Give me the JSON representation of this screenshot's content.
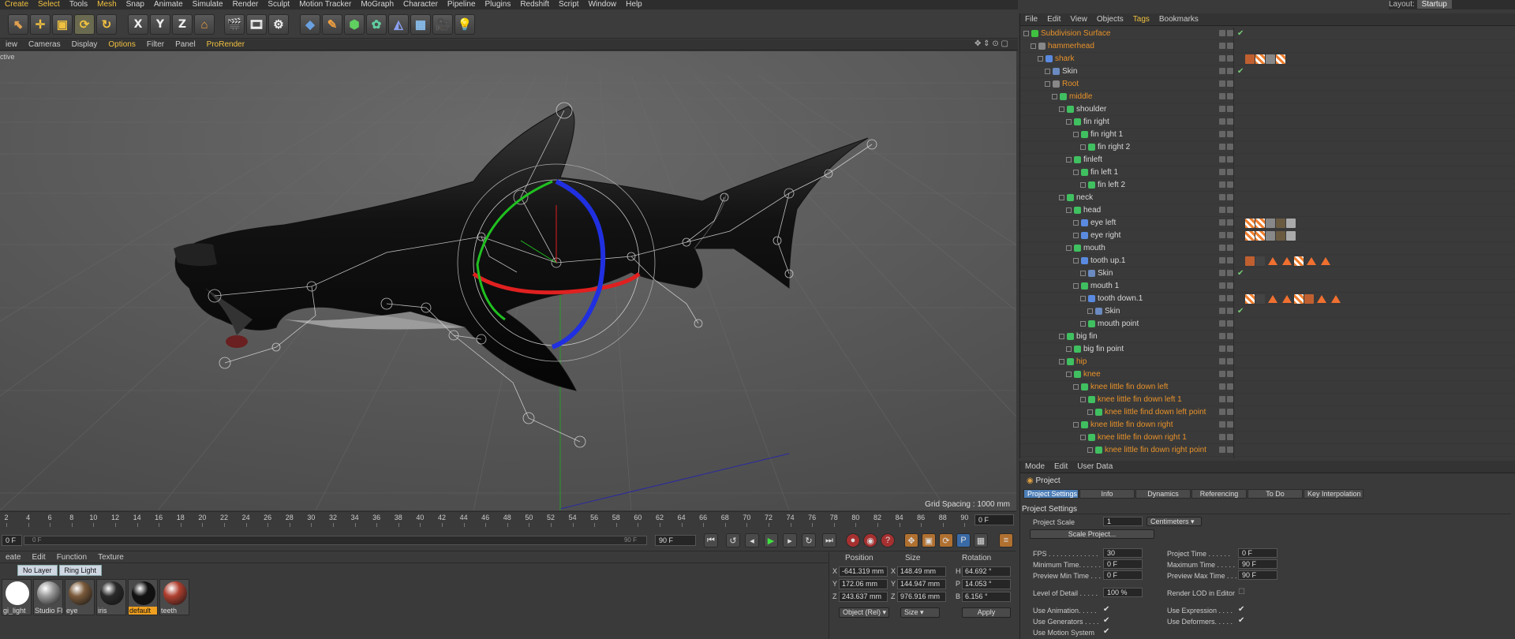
{
  "menubar": [
    "Create",
    "Select",
    "Tools",
    "Mesh",
    "Snap",
    "Animate",
    "Simulate",
    "Render",
    "Sculpt",
    "Motion Tracker",
    "MoGraph",
    "Character",
    "Pipeline",
    "Plugins",
    "Redshift",
    "Script",
    "Window",
    "Help"
  ],
  "layout": {
    "label": "Layout:",
    "value": "Startup"
  },
  "toolbar": {
    "x": "X",
    "y": "Y",
    "z": "Z"
  },
  "viewport_menu": [
    "iew",
    "Cameras",
    "Display",
    "Options",
    "Filter",
    "Panel",
    "ProRender"
  ],
  "viewport": {
    "label": "ctive",
    "grid_spacing": "Grid Spacing : 1000 mm"
  },
  "timeline": {
    "ticks": [
      "2",
      "4",
      "6",
      "8",
      "10",
      "12",
      "14",
      "16",
      "18",
      "20",
      "22",
      "24",
      "26",
      "28",
      "30",
      "32",
      "34",
      "36",
      "38",
      "40",
      "42",
      "44",
      "46",
      "48",
      "50",
      "52",
      "54",
      "56",
      "58",
      "60",
      "62",
      "64",
      "66",
      "68",
      "70",
      "72",
      "74",
      "76",
      "78",
      "80",
      "82",
      "84",
      "86",
      "88",
      "90"
    ],
    "current_frame": "0 F"
  },
  "playbar": {
    "start": "0 F",
    "range_start": "0 F",
    "range_end": "90 F",
    "end": "90 F"
  },
  "material_manager": {
    "menu": [
      "eate",
      "Edit",
      "Function",
      "Texture"
    ],
    "layers": [
      "No Layer",
      "Ring Light"
    ],
    "materials": [
      {
        "name": "gi_light",
        "color": "#ffffff"
      },
      {
        "name": "Studio Fl",
        "color": "#9a9a9a"
      },
      {
        "name": "eye",
        "color": "#7a5a3a"
      },
      {
        "name": "iris",
        "color": "#2a2a2a"
      },
      {
        "name": "default",
        "color": "#111111"
      },
      {
        "name": "teeth",
        "color": "#b04030"
      }
    ]
  },
  "coordinates": {
    "headers": [
      "Position",
      "Size",
      "Rotation"
    ],
    "axes": [
      "X",
      "Y",
      "Z"
    ],
    "rot_axes": [
      "H",
      "P",
      "B"
    ],
    "position": [
      "-641.319 mm",
      "172.06 mm",
      "243.637 mm"
    ],
    "size": [
      "148.49 mm",
      "144.947 mm",
      "976.916 mm"
    ],
    "rotation": [
      "64.692 °",
      "14.053 °",
      "6.156 °"
    ],
    "mode": "Object (Rel)",
    "size_mode": "Size",
    "apply": "Apply"
  },
  "object_manager": {
    "menu": [
      "File",
      "Edit",
      "View",
      "Objects",
      "Tags",
      "Bookmarks"
    ],
    "rows": [
      {
        "name": "Subdivision Surface",
        "indent": 0,
        "orange": true
      },
      {
        "name": "hammerhead",
        "indent": 1,
        "orange": true
      },
      {
        "name": "shark",
        "indent": 2,
        "orange": true
      },
      {
        "name": "Skin",
        "indent": 3,
        "orange": false
      },
      {
        "name": "Root",
        "indent": 3,
        "orange": true
      },
      {
        "name": "middle",
        "indent": 4,
        "orange": true
      },
      {
        "name": "shoulder",
        "indent": 5,
        "orange": false
      },
      {
        "name": "fin right",
        "indent": 6,
        "orange": false
      },
      {
        "name": "fin right 1",
        "indent": 7,
        "orange": false
      },
      {
        "name": "fin right 2",
        "indent": 8,
        "orange": false
      },
      {
        "name": "finleft",
        "indent": 6,
        "orange": false
      },
      {
        "name": "fin left 1",
        "indent": 7,
        "orange": false
      },
      {
        "name": "fin left 2",
        "indent": 8,
        "orange": false
      },
      {
        "name": "neck",
        "indent": 5,
        "orange": false
      },
      {
        "name": "head",
        "indent": 6,
        "orange": false
      },
      {
        "name": "eye left",
        "indent": 7,
        "orange": false
      },
      {
        "name": "eye right",
        "indent": 7,
        "orange": false
      },
      {
        "name": "mouth",
        "indent": 6,
        "orange": false
      },
      {
        "name": "tooth up.1",
        "indent": 7,
        "orange": false
      },
      {
        "name": "Skin",
        "indent": 8,
        "orange": false
      },
      {
        "name": "mouth 1",
        "indent": 7,
        "orange": false
      },
      {
        "name": "tooth down.1",
        "indent": 8,
        "orange": false
      },
      {
        "name": "Skin",
        "indent": 9,
        "orange": false
      },
      {
        "name": "mouth point",
        "indent": 8,
        "orange": false
      },
      {
        "name": "big fin",
        "indent": 5,
        "orange": false
      },
      {
        "name": "big fin point",
        "indent": 6,
        "orange": false
      },
      {
        "name": "hip",
        "indent": 5,
        "orange": true
      },
      {
        "name": "knee",
        "indent": 6,
        "orange": true
      },
      {
        "name": "knee little fin down left",
        "indent": 7,
        "orange": true
      },
      {
        "name": "knee little fin down left 1",
        "indent": 8,
        "orange": true
      },
      {
        "name": "knee little find down left point",
        "indent": 9,
        "orange": true
      },
      {
        "name": "knee little fin down right",
        "indent": 7,
        "orange": true
      },
      {
        "name": "knee little fin down right 1",
        "indent": 8,
        "orange": true
      },
      {
        "name": "knee little fin down right point",
        "indent": 9,
        "orange": true
      }
    ]
  },
  "attributes": {
    "menu": [
      "Mode",
      "Edit",
      "User Data"
    ],
    "title": "Project",
    "tabs": [
      "Project Settings",
      "Info",
      "Dynamics",
      "Referencing",
      "To Do",
      "Key Interpolation"
    ],
    "section": "Project Settings",
    "project_scale_label": "Project Scale",
    "project_scale_value": "1",
    "project_scale_unit": "Centimeters",
    "scale_project_btn": "Scale Project...",
    "fps_label": "FPS . . . . . . . . . . . . .",
    "fps": "30",
    "project_time_label": "Project Time . . . . . .",
    "project_time": "0 F",
    "min_time_label": "Minimum Time. . . . . .",
    "min_time": "0 F",
    "max_time_label": "Maximum Time . . . . .",
    "max_time": "90 F",
    "prev_min_label": "Preview Min Time . . .",
    "prev_min": "0 F",
    "prev_max_label": "Preview Max Time . . .",
    "prev_max": "90 F",
    "lod_label": "Level of Detail . . . . .",
    "lod": "100 %",
    "render_lod_label": "Render LOD in Editor",
    "use_animation": "Use Animation. . . . .",
    "use_expression": "Use Expression . . . .",
    "use_generators": "Use Generators . . . .",
    "use_deformers": "Use Deformers. . . . .",
    "use_motion": "Use Motion System"
  }
}
